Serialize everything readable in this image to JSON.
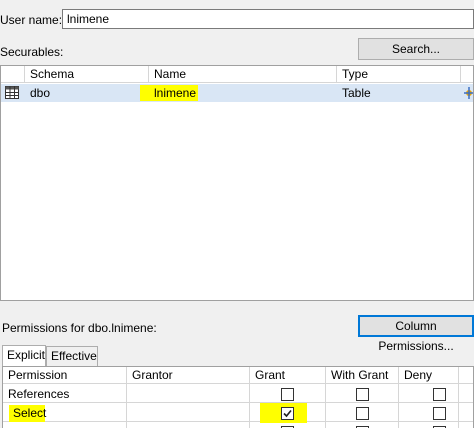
{
  "user_name": {
    "label": "User name:",
    "value": "lnimene"
  },
  "securables": {
    "label": "Securables:",
    "search_button": "Search...",
    "columns": [
      "Schema",
      "Name",
      "Type"
    ],
    "rows": [
      {
        "schema": "dbo",
        "name": "lnimene",
        "type": "Table"
      }
    ]
  },
  "permissions": {
    "label": "Permissions for dbo.lnimene:",
    "column_permissions_button": "Column Permissions...",
    "tabs": [
      "Explicit",
      "Effective"
    ],
    "active_tab": "Explicit",
    "columns": [
      "Permission",
      "Grantor",
      "Grant",
      "With Grant",
      "Deny"
    ],
    "rows": [
      {
        "permission": "References",
        "grantor": "",
        "grant": false,
        "with_grant": false,
        "deny": false
      },
      {
        "permission": "Select",
        "grantor": "",
        "grant": true,
        "with_grant": false,
        "deny": false
      }
    ]
  },
  "highlight_color": "#ffff00",
  "selection_color": "#d9e6f5"
}
